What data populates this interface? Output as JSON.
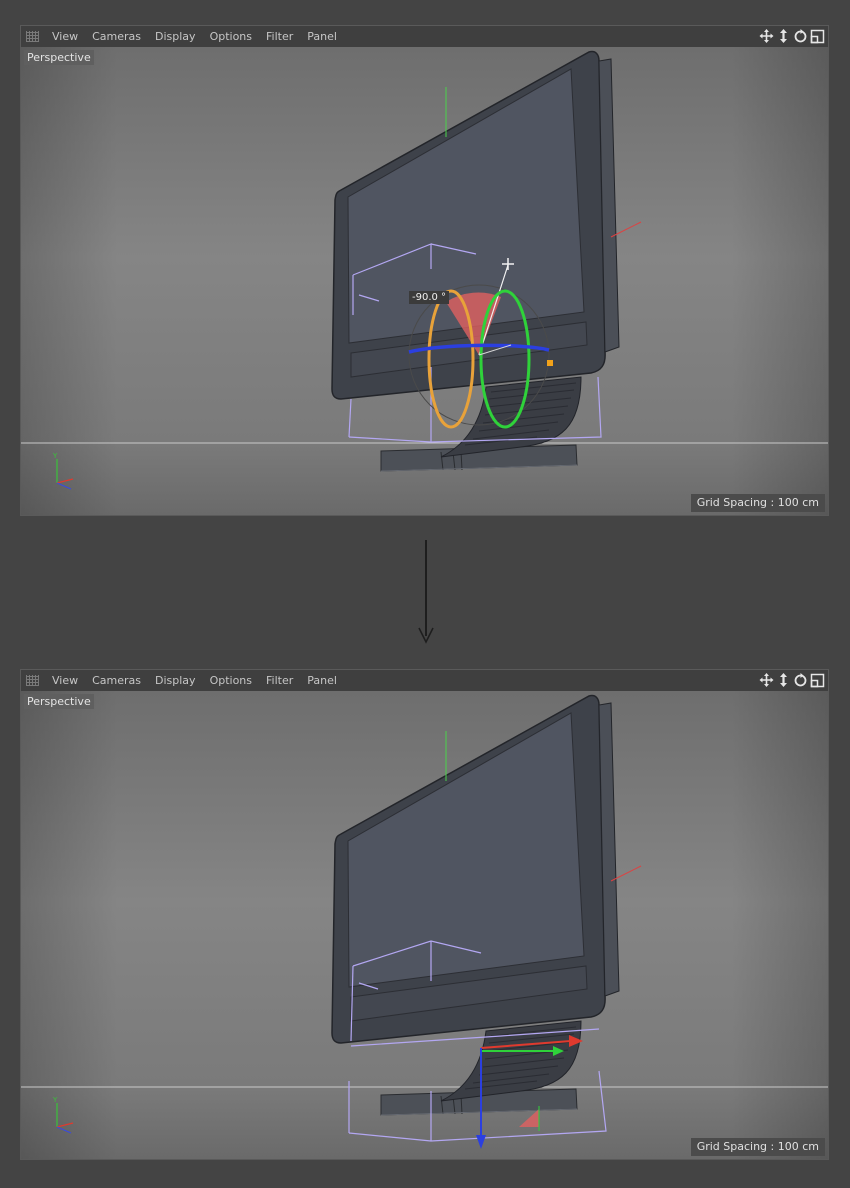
{
  "menu": [
    "View",
    "Cameras",
    "Display",
    "Options",
    "Filter",
    "Panel"
  ],
  "nav_icons": [
    "move-icon",
    "zoom-icon",
    "rotate-icon",
    "maximize-icon"
  ],
  "viewports": [
    {
      "camera_label": "Perspective",
      "grid_spacing": "Grid Spacing : 100 cm",
      "rotation_readout": "-90.0 °",
      "tool": "rotate"
    },
    {
      "camera_label": "Perspective",
      "grid_spacing": "Grid Spacing : 100 cm",
      "tool": "move"
    }
  ],
  "colors": {
    "background": "#444444",
    "x_axis": "#e03a2e",
    "y_axis": "#2fd23a",
    "z_axis": "#2b3fe0",
    "rotation_arc": "#e8a23a",
    "bounding_box": "#b3a7f2"
  }
}
